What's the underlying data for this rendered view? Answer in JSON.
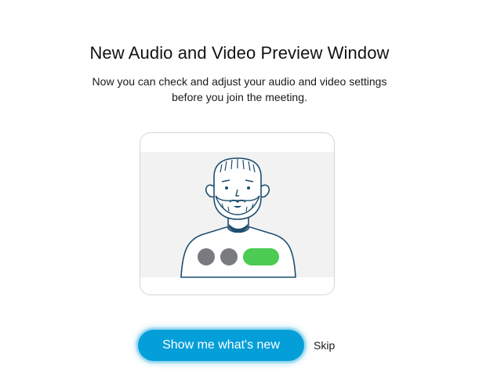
{
  "dialog": {
    "title": "New Audio and Video Preview Window",
    "subtitle_line1": "Now you can check and adjust your audio and video settings",
    "subtitle_line2": "before you join the meeting."
  },
  "illustration": {
    "icon": "person-video-preview-icon",
    "colors": {
      "background": "#f2f2f2",
      "outline": "#1d4e6e",
      "control_grey": "#7a7b7e",
      "control_green": "#4ccc52"
    }
  },
  "actions": {
    "primary_label": "Show me what's new",
    "skip_label": "Skip",
    "primary_color": "#049fd9"
  }
}
